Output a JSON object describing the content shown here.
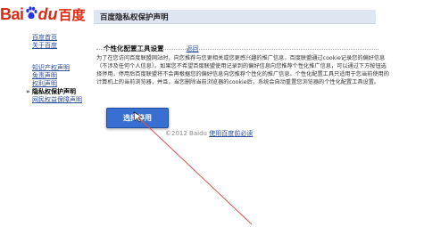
{
  "logo": {
    "bai": "Bai",
    "du": "du",
    "cn": "百度"
  },
  "header": {
    "title": "百度隐私权保护声明"
  },
  "sidebar": {
    "items": [
      {
        "label": "百度首页"
      },
      {
        "label": "关于百度"
      },
      {
        "label": "知识产权声明"
      },
      {
        "label": "免责声明"
      },
      {
        "label": "权利声明"
      },
      {
        "label": "隐私权保护声明"
      },
      {
        "label": "网民权益保障声明"
      }
    ]
  },
  "content": {
    "subtitle": "个性化配置工具设置",
    "back_link": "返回",
    "paragraph": "为了在您访问百度联盟网站时，向您推荐与您更相关或您更感兴趣的推广信息，百度联盟通过cookie记录您的偏好信息（不涉及任何个人信息）。如果您不希望百度联盟使用记录到的偏好信息向您推荐个性化推广信息，可以通过下方按钮选择停用，停用后百度联盟将不会再根据您的偏好信息向您推荐个性化的推广信息。个性化配置工具只适用于您当前使用的计算机上的当前浏览器，并且，当您删除当前浏览器的cookie后，系统会自动重置您浏览器的个性化配置工具设置。",
    "button_label": "选择停用"
  },
  "footer": {
    "copyright": "©2012 Baidu",
    "link": "使用百度前必读"
  },
  "colors": {
    "brand_red": "#de2910",
    "brand_blue": "#2932e1",
    "link": "#2d4fa0",
    "button": "#3a6fd2",
    "header_bar": "#dfe6f1"
  }
}
